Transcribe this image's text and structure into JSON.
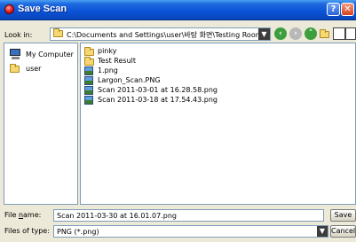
{
  "window": {
    "title": "Save Scan",
    "help_label": "?",
    "close_label": "✕"
  },
  "lookin": {
    "label": "Look in:",
    "value": "C:\\Documents and Settings\\user\\바탕 화면\\Testing Room"
  },
  "places": [
    {
      "label": "My Computer",
      "icon": "computer-icon"
    },
    {
      "label": "user",
      "icon": "folder-icon"
    }
  ],
  "files": [
    {
      "name": "pinky",
      "type": "folder"
    },
    {
      "name": "Test Result",
      "type": "folder"
    },
    {
      "name": "1.png",
      "type": "png"
    },
    {
      "name": "Largon_Scan.PNG",
      "type": "png"
    },
    {
      "name": "Scan 2011-03-01 at 16.28.58.png",
      "type": "png"
    },
    {
      "name": "Scan 2011-03-18 at 17.54.43.png",
      "type": "png"
    }
  ],
  "filename": {
    "label_pre": "File ",
    "label_ul": "n",
    "label_post": "ame:",
    "value": "Scan 2011-03-30 at 16.01.07.png"
  },
  "filetype": {
    "label": "Files of type:",
    "value": "PNG (*.png)"
  },
  "buttons": {
    "save": "Save",
    "cancel": "Cancel"
  },
  "colors": {
    "titlebar": "#0a52d6",
    "window_bg": "#ece9d8"
  }
}
